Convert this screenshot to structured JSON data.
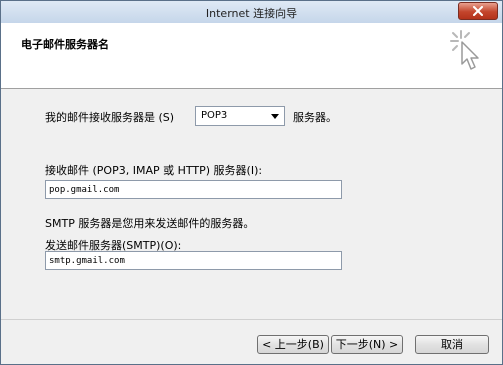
{
  "window": {
    "title": "Internet 连接向导"
  },
  "header": {
    "title": "电子邮件服务器名"
  },
  "form": {
    "incoming_type_label": "我的邮件接收服务器是 (S)",
    "incoming_type_value": "POP3",
    "incoming_type_suffix": "服务器。",
    "incoming_server_label": "接收邮件 (POP3, IMAP 或 HTTP) 服务器(I):",
    "incoming_server_value": "pop.gmail.com",
    "smtp_note": "SMTP 服务器是您用来发送邮件的服务器。",
    "outgoing_server_label": "发送邮件服务器(SMTP)(O):",
    "outgoing_server_value": "smtp.gmail.com"
  },
  "buttons": {
    "back": "< 上一步(B)",
    "next": "下一步(N) >",
    "cancel": "取消"
  },
  "icons": {
    "close": "close-icon",
    "wizard": "wizard-cursor-icon",
    "dropdown": "chevron-down-icon"
  }
}
